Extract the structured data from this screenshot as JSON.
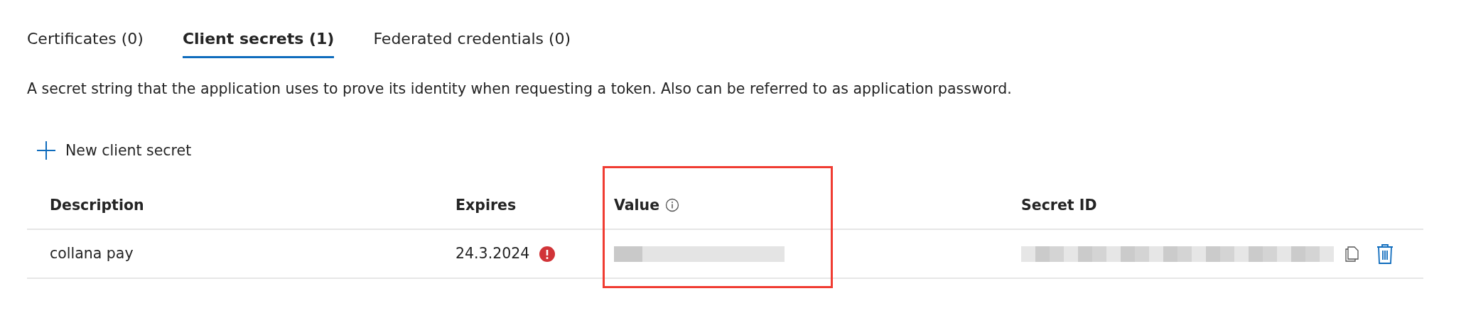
{
  "tabs": [
    {
      "label": "Certificates (0)",
      "selected": false
    },
    {
      "label": "Client secrets (1)",
      "selected": true
    },
    {
      "label": "Federated credentials (0)",
      "selected": false
    }
  ],
  "description": "A secret string that the application uses to prove its identity when requesting a token. Also can be referred to as application password.",
  "new_button": {
    "label": "New client secret"
  },
  "table": {
    "columns": [
      {
        "label": "Description",
        "info": false,
        "highlighted": false
      },
      {
        "label": "Expires",
        "info": false,
        "highlighted": false
      },
      {
        "label": "Value",
        "info": true,
        "highlighted": true
      },
      {
        "label": "Secret ID",
        "info": false,
        "highlighted": false
      }
    ],
    "rows": [
      {
        "description": "collana pay",
        "expires": "24.3.2024",
        "expired": true,
        "value_redacted": true,
        "secret_id_redacted": true
      }
    ]
  }
}
